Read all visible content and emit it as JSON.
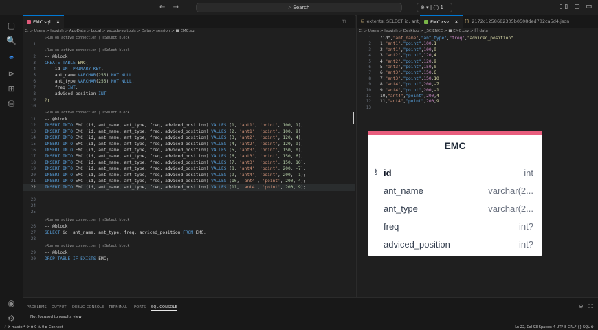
{
  "titlebar": {
    "back": "←",
    "forward": "→",
    "search_placeholder": "Search",
    "copilot": "⊕ ▾ | ◯ 1",
    "window_controls": "▯▯ ▢ ▭"
  },
  "activity": [
    "▢",
    "🔍",
    "⚭",
    "⊳",
    "⊞",
    "⛁"
  ],
  "left_tab": {
    "label": "EMC.sql",
    "close": "✕"
  },
  "left_breadcrumb": "C: > Users > leovish > AppData > Local > vscode-sqltools > Data > session > ■ EMC.sql",
  "codelens": "▷Run on active connection | ≡Select block",
  "sql_lines": [
    "",
    "-- @block",
    "CREATE TABLE EMC(",
    "    id INT PRIMARY KEY,",
    "    ant_name VARCHAR(255) NOT NULL,",
    "    ant_type VARCHAR(255) NOT NULL,",
    "    freq INT,",
    "    adviced_position INT",
    ");",
    "",
    "-- @block",
    "INSERT INTO EMC (id, ant_name, ant_type, freq, adviced_position) VALUES (1, 'ant1', 'point', 100, 1);",
    "INSERT INTO EMC (id, ant_name, ant_type, freq, adviced_position) VALUES (2, 'ant1', 'point', 100, 9);",
    "INSERT INTO EMC (id, ant_name, ant_type, freq, adviced_position) VALUES (3, 'ant2', 'point', 120, 4);",
    "INSERT INTO EMC (id, ant_name, ant_type, freq, adviced_position) VALUES (4, 'ant2', 'point', 120, 9);",
    "INSERT INTO EMC (id, ant_name, ant_type, freq, adviced_position) VALUES (5, 'ant3', 'point', 150, 0);",
    "INSERT INTO EMC (id, ant_name, ant_type, freq, adviced_position) VALUES (6, 'ant3', 'point', 150, 6);",
    "INSERT INTO EMC (id, ant_name, ant_type, freq, adviced_position) VALUES (7, 'ant3', 'point', 150, 10);",
    "INSERT INTO EMC (id, ant_name, ant_type, freq, adviced_position) VALUES (8, 'ant4', 'point', 200, -7);",
    "INSERT INTO EMC (id, ant_name, ant_type, freq, adviced_position) VALUES (9, 'ant4', 'point', 200, -1);",
    "INSERT INTO EMC (id, ant_name, ant_type, freq, adviced_position) VALUES (10, 'ant4', 'point', 200, 4);",
    "INSERT INTO EMC (id, ant_name, ant_type, freq, adviced_position) VALUES (11, 'ant4', 'point', 200, 9);",
    "",
    "",
    "",
    "-- @block",
    "SELECT id, ant_name, ant_type, freq, adviced_position FROM EMC;",
    "",
    "-- @block",
    "DROP TABLE IF EXISTS EMC;"
  ],
  "right_tabs": [
    {
      "label": "extents: SELECT id, ant_n...",
      "icon": "db"
    },
    {
      "label": "EMC.csv",
      "icon": "csv",
      "close": "✕"
    },
    {
      "label": "2172c1258682305b0508ded782ca5d4.json",
      "icon": "json"
    }
  ],
  "right_breadcrumb": "C: > Users > leovish > Desktop > _SCIENCE > ■ EMC.csv > ⟦⟧ data",
  "csv_lines": [
    [
      "\"id\"",
      "\"ant_name\"",
      "\"ant_type\"",
      "\"freq\"",
      "\"adviced_position\""
    ],
    [
      "1",
      "\"ant1\"",
      "\"point\"",
      "100",
      "1"
    ],
    [
      "2",
      "\"ant1\"",
      "\"point\"",
      "100",
      "9"
    ],
    [
      "3",
      "\"ant2\"",
      "\"point\"",
      "120",
      "4"
    ],
    [
      "4",
      "\"ant2\"",
      "\"point\"",
      "120",
      "9"
    ],
    [
      "5",
      "\"ant3\"",
      "\"point\"",
      "150",
      "0"
    ],
    [
      "6",
      "\"ant3\"",
      "\"point\"",
      "150",
      "6"
    ],
    [
      "7",
      "\"ant3\"",
      "\"point\"",
      "150",
      "10"
    ],
    [
      "8",
      "\"ant4\"",
      "\"point\"",
      "200",
      "-7"
    ],
    [
      "9",
      "\"ant4\"",
      "\"point\"",
      "200",
      "-1"
    ],
    [
      "10",
      "\"ant4\"",
      "\"point\"",
      "200",
      "4"
    ],
    [
      "11",
      "\"ant4\"",
      "\"point\"",
      "200",
      "9"
    ]
  ],
  "er": {
    "title": "EMC",
    "columns": [
      {
        "name": "id",
        "type": "int",
        "key": "⚷"
      },
      {
        "name": "ant_name",
        "type": "varchar(2..."
      },
      {
        "name": "ant_type",
        "type": "varchar(2..."
      },
      {
        "name": "freq",
        "type": "int?"
      },
      {
        "name": "adviced_position",
        "type": "int?"
      }
    ]
  },
  "panel": {
    "tabs": [
      "PROBLEMS",
      "OUTPUT",
      "DEBUG CONSOLE",
      "TERMINAL",
      "PORTS",
      "SQL CONSOLE"
    ],
    "message": "Not focused to results view",
    "right": "⊖ | ⛶"
  },
  "status": {
    "left": "⚡ ✗ master* ⟳  ⊗ 0 ⚠ 0  ⧖ Connect",
    "right": "Ln 22, Col 93  Spaces: 4  UTF-8  CRLF  {} SQL  ⚙"
  },
  "colors": {
    "accent": "#0078d4",
    "er_header": "#e85d7d"
  }
}
